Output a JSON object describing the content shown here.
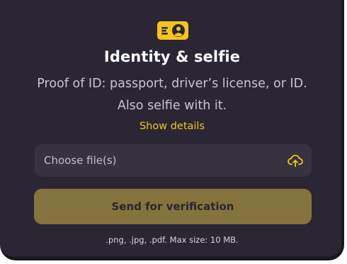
{
  "section": {
    "icon": "id-card-icon",
    "title": "Identity & selfie",
    "description_line1": "Proof of ID: passport, driver’s license, or ID.",
    "description_line2": "Also selfie with it.",
    "details_link": "Show details"
  },
  "upload": {
    "label": "Choose file(s)",
    "icon": "upload-cloud-icon",
    "hint": ".png, .jpg, .pdf. Max size: 10 MB."
  },
  "actions": {
    "send_label": "Send for verification"
  },
  "colors": {
    "background": "#2a2633",
    "field": "#36323f",
    "accent": "#f5c518",
    "button_disabled": "#85733d"
  }
}
